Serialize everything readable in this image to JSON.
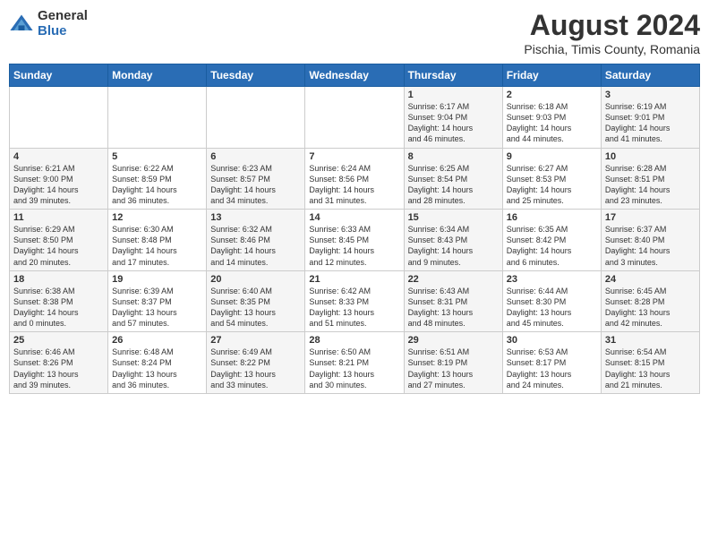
{
  "logo": {
    "general": "General",
    "blue": "Blue"
  },
  "title": "August 2024",
  "subtitle": "Pischia, Timis County, Romania",
  "days_of_week": [
    "Sunday",
    "Monday",
    "Tuesday",
    "Wednesday",
    "Thursday",
    "Friday",
    "Saturday"
  ],
  "weeks": [
    [
      {
        "day": "",
        "info": ""
      },
      {
        "day": "",
        "info": ""
      },
      {
        "day": "",
        "info": ""
      },
      {
        "day": "",
        "info": ""
      },
      {
        "day": "1",
        "info": "Sunrise: 6:17 AM\nSunset: 9:04 PM\nDaylight: 14 hours\nand 46 minutes."
      },
      {
        "day": "2",
        "info": "Sunrise: 6:18 AM\nSunset: 9:03 PM\nDaylight: 14 hours\nand 44 minutes."
      },
      {
        "day": "3",
        "info": "Sunrise: 6:19 AM\nSunset: 9:01 PM\nDaylight: 14 hours\nand 41 minutes."
      }
    ],
    [
      {
        "day": "4",
        "info": "Sunrise: 6:21 AM\nSunset: 9:00 PM\nDaylight: 14 hours\nand 39 minutes."
      },
      {
        "day": "5",
        "info": "Sunrise: 6:22 AM\nSunset: 8:59 PM\nDaylight: 14 hours\nand 36 minutes."
      },
      {
        "day": "6",
        "info": "Sunrise: 6:23 AM\nSunset: 8:57 PM\nDaylight: 14 hours\nand 34 minutes."
      },
      {
        "day": "7",
        "info": "Sunrise: 6:24 AM\nSunset: 8:56 PM\nDaylight: 14 hours\nand 31 minutes."
      },
      {
        "day": "8",
        "info": "Sunrise: 6:25 AM\nSunset: 8:54 PM\nDaylight: 14 hours\nand 28 minutes."
      },
      {
        "day": "9",
        "info": "Sunrise: 6:27 AM\nSunset: 8:53 PM\nDaylight: 14 hours\nand 25 minutes."
      },
      {
        "day": "10",
        "info": "Sunrise: 6:28 AM\nSunset: 8:51 PM\nDaylight: 14 hours\nand 23 minutes."
      }
    ],
    [
      {
        "day": "11",
        "info": "Sunrise: 6:29 AM\nSunset: 8:50 PM\nDaylight: 14 hours\nand 20 minutes."
      },
      {
        "day": "12",
        "info": "Sunrise: 6:30 AM\nSunset: 8:48 PM\nDaylight: 14 hours\nand 17 minutes."
      },
      {
        "day": "13",
        "info": "Sunrise: 6:32 AM\nSunset: 8:46 PM\nDaylight: 14 hours\nand 14 minutes."
      },
      {
        "day": "14",
        "info": "Sunrise: 6:33 AM\nSunset: 8:45 PM\nDaylight: 14 hours\nand 12 minutes."
      },
      {
        "day": "15",
        "info": "Sunrise: 6:34 AM\nSunset: 8:43 PM\nDaylight: 14 hours\nand 9 minutes."
      },
      {
        "day": "16",
        "info": "Sunrise: 6:35 AM\nSunset: 8:42 PM\nDaylight: 14 hours\nand 6 minutes."
      },
      {
        "day": "17",
        "info": "Sunrise: 6:37 AM\nSunset: 8:40 PM\nDaylight: 14 hours\nand 3 minutes."
      }
    ],
    [
      {
        "day": "18",
        "info": "Sunrise: 6:38 AM\nSunset: 8:38 PM\nDaylight: 14 hours\nand 0 minutes."
      },
      {
        "day": "19",
        "info": "Sunrise: 6:39 AM\nSunset: 8:37 PM\nDaylight: 13 hours\nand 57 minutes."
      },
      {
        "day": "20",
        "info": "Sunrise: 6:40 AM\nSunset: 8:35 PM\nDaylight: 13 hours\nand 54 minutes."
      },
      {
        "day": "21",
        "info": "Sunrise: 6:42 AM\nSunset: 8:33 PM\nDaylight: 13 hours\nand 51 minutes."
      },
      {
        "day": "22",
        "info": "Sunrise: 6:43 AM\nSunset: 8:31 PM\nDaylight: 13 hours\nand 48 minutes."
      },
      {
        "day": "23",
        "info": "Sunrise: 6:44 AM\nSunset: 8:30 PM\nDaylight: 13 hours\nand 45 minutes."
      },
      {
        "day": "24",
        "info": "Sunrise: 6:45 AM\nSunset: 8:28 PM\nDaylight: 13 hours\nand 42 minutes."
      }
    ],
    [
      {
        "day": "25",
        "info": "Sunrise: 6:46 AM\nSunset: 8:26 PM\nDaylight: 13 hours\nand 39 minutes."
      },
      {
        "day": "26",
        "info": "Sunrise: 6:48 AM\nSunset: 8:24 PM\nDaylight: 13 hours\nand 36 minutes."
      },
      {
        "day": "27",
        "info": "Sunrise: 6:49 AM\nSunset: 8:22 PM\nDaylight: 13 hours\nand 33 minutes."
      },
      {
        "day": "28",
        "info": "Sunrise: 6:50 AM\nSunset: 8:21 PM\nDaylight: 13 hours\nand 30 minutes."
      },
      {
        "day": "29",
        "info": "Sunrise: 6:51 AM\nSunset: 8:19 PM\nDaylight: 13 hours\nand 27 minutes."
      },
      {
        "day": "30",
        "info": "Sunrise: 6:53 AM\nSunset: 8:17 PM\nDaylight: 13 hours\nand 24 minutes."
      },
      {
        "day": "31",
        "info": "Sunrise: 6:54 AM\nSunset: 8:15 PM\nDaylight: 13 hours\nand 21 minutes."
      }
    ]
  ]
}
